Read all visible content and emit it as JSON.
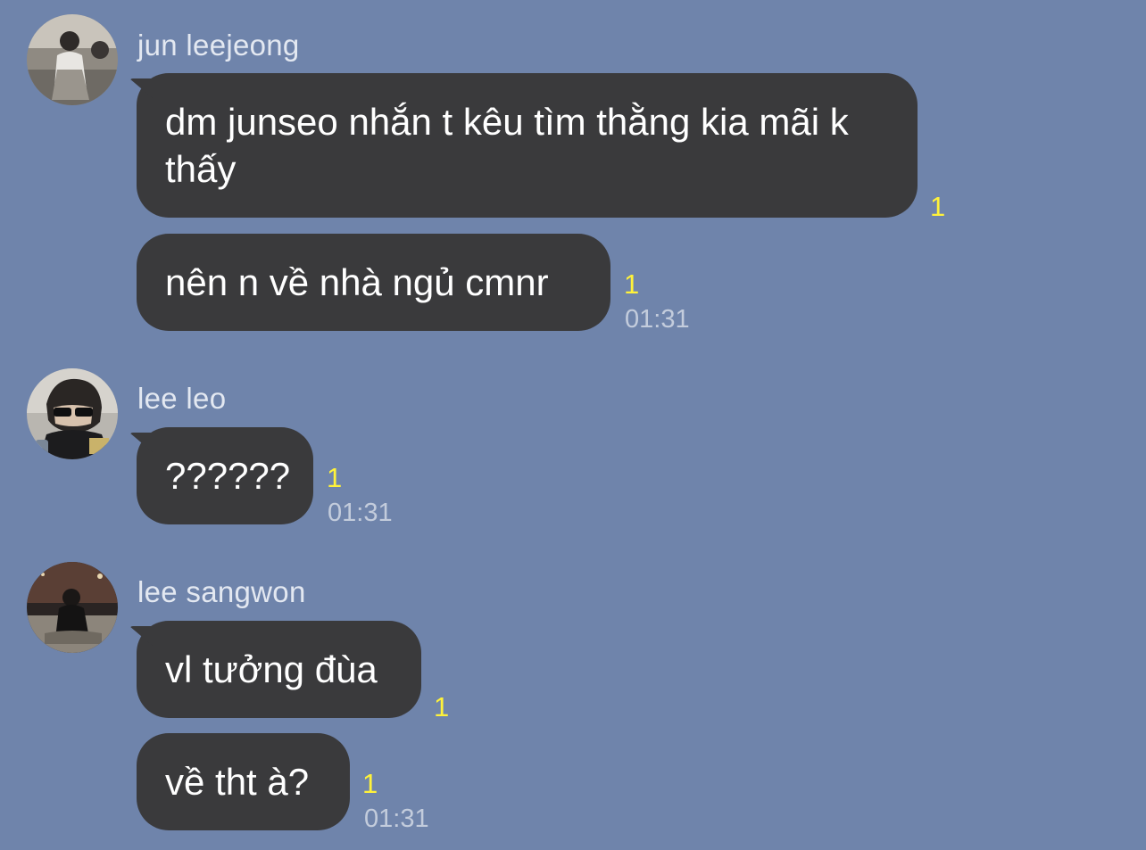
{
  "chat": {
    "groups": [
      {
        "sender": "jun leejeong",
        "messages": [
          {
            "text": "dm junseo nhắn t kêu tìm thằng kia mãi k thấy",
            "read": "1",
            "time": ""
          },
          {
            "text": "nên n về nhà ngủ cmnr",
            "read": "1",
            "time": "01:31"
          }
        ]
      },
      {
        "sender": "lee leo",
        "messages": [
          {
            "text": "??????",
            "read": "1",
            "time": "01:31"
          }
        ]
      },
      {
        "sender": "lee sangwon",
        "messages": [
          {
            "text": "vl tưởng đùa",
            "read": "1",
            "time": ""
          },
          {
            "text": "về tht à?",
            "read": "1",
            "time": "01:31"
          }
        ]
      }
    ]
  },
  "colors": {
    "background": "#6f84ab",
    "bubble": "#3a3a3c",
    "read_indicator": "#fff23a"
  },
  "icons": [
    "avatar-jun-leejeong",
    "avatar-lee-leo",
    "avatar-lee-sangwon"
  ]
}
